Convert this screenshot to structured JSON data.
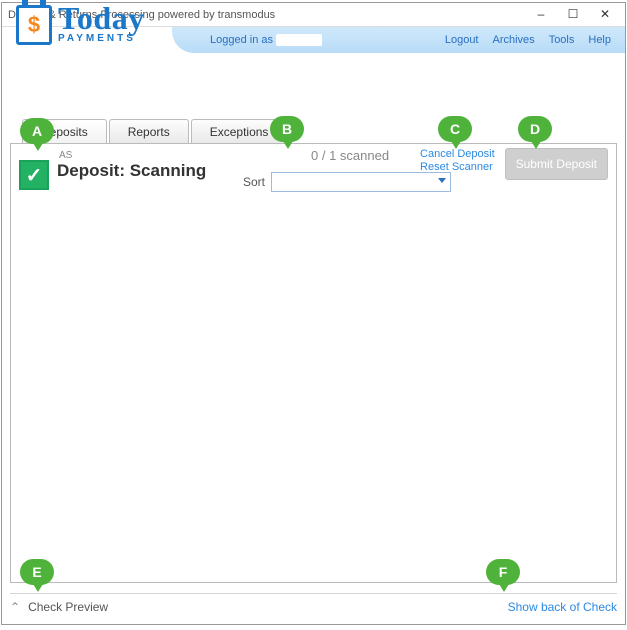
{
  "window": {
    "title": "Deposit & Returns Processing powered by transmodus"
  },
  "ribbon": {
    "loggedin_prefix": "Logged in as",
    "logout": "Logout",
    "archives": "Archives",
    "tools": "Tools",
    "help": "Help"
  },
  "logo": {
    "today": "Today",
    "payments": "PAYMENTS",
    "dollar": "$"
  },
  "tabs": {
    "deposits": "Deposits",
    "reports": "Reports",
    "exceptions": "Exceptions"
  },
  "deposit": {
    "as": "AS",
    "title": "Deposit: Scanning",
    "scanned": "0 / 1 scanned",
    "sort_label": "Sort",
    "cancel": "Cancel Deposit",
    "reset": "Reset Scanner",
    "submit": "Submit Deposit"
  },
  "status": {
    "preview": "Check Preview",
    "showback": "Show back of Check"
  },
  "callouts": {
    "A": "A",
    "B": "B",
    "C": "C",
    "D": "D",
    "E": "E",
    "F": "F"
  }
}
